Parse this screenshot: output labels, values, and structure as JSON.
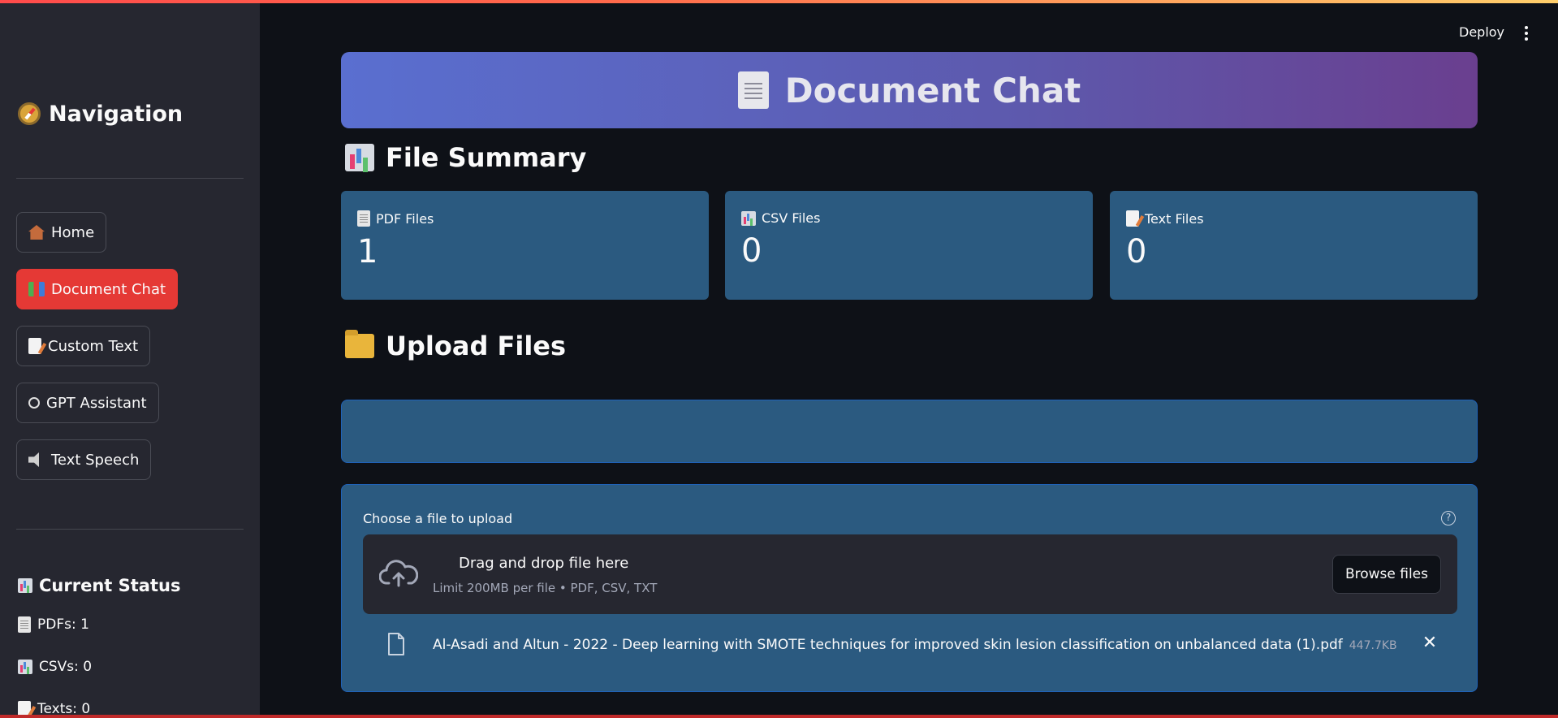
{
  "header": {
    "deploy_label": "Deploy",
    "menu_icon": "kebab-menu-icon"
  },
  "sidebar": {
    "title": "Navigation",
    "items": [
      {
        "label": "Home",
        "icon": "home-icon",
        "active": false
      },
      {
        "label": "Document Chat",
        "icon": "books-icon",
        "active": true
      },
      {
        "label": "Custom Text",
        "icon": "memo-icon",
        "active": false
      },
      {
        "label": "GPT Assistant",
        "icon": "brain-icon",
        "active": false
      },
      {
        "label": "Text Speech",
        "icon": "speaker-icon",
        "active": false
      }
    ],
    "status": {
      "title": "Current Status",
      "lines": [
        "PDFs: 1",
        "CSVs: 0",
        "Texts: 0"
      ]
    }
  },
  "main": {
    "banner_title": "Document Chat",
    "file_summary": {
      "title": "File Summary",
      "metrics": [
        {
          "label": "PDF Files",
          "value": "1"
        },
        {
          "label": "CSV Files",
          "value": "0"
        },
        {
          "label": "Text Files",
          "value": "0"
        }
      ]
    },
    "upload": {
      "title": "Upload Files",
      "label": "Choose a file to upload",
      "help_glyph": "?",
      "drop_title": "Drag and drop file here",
      "drop_limit": "Limit 200MB per file • PDF, CSV, TXT",
      "browse_label": "Browse files",
      "file": {
        "name": "Al-Asadi and Altun - 2022 - Deep learning with SMOTE techniques for improved skin lesion classification on unbalanced data (1).pdf",
        "size": "447.7KB"
      }
    }
  },
  "colors": {
    "active_button": "#e53935",
    "metric_bg": "#2b5a80",
    "background": "#0e1117",
    "sidebar_bg": "#262730"
  }
}
